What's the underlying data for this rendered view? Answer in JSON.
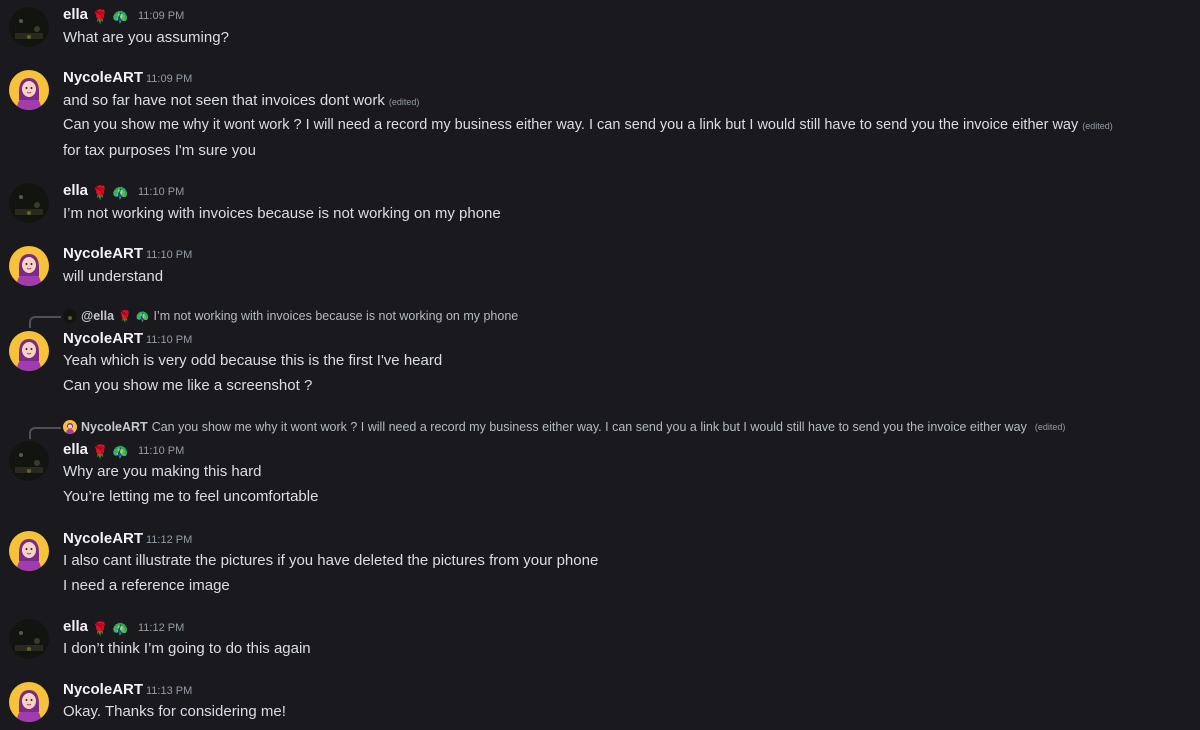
{
  "users": {
    "ella": {
      "name": "ella",
      "emoji_rose": "🌹",
      "emoji_peacock": "🦚"
    },
    "nycole": {
      "name": "NycoleART"
    }
  },
  "messages": [
    {
      "author": "ella",
      "time": "11:09 PM",
      "lines": [
        {
          "text": "What are you assuming?"
        }
      ]
    },
    {
      "author": "NycoleART",
      "time": "11:09 PM",
      "lines": [
        {
          "text": "and so far have not seen that invoices dont work",
          "edited": "(edited)"
        },
        {
          "text": "Can you show me why it wont work ? I will need a record my business either way. I can send you a link but I would still have to send you the invoice either way",
          "edited": "(edited)"
        },
        {
          "text": "for tax purposes I'm sure you"
        }
      ]
    },
    {
      "author": "ella",
      "time": "11:10 PM",
      "lines": [
        {
          "text": "I’m not working with invoices because is not working on my phone"
        }
      ]
    },
    {
      "author": "NycoleART",
      "time": "11:10 PM",
      "lines": [
        {
          "text": "will understand"
        }
      ]
    },
    {
      "author": "NycoleART",
      "time": "11:10 PM",
      "reply": {
        "name": "@ella",
        "text": "I’m not working with invoices because is not working on my phone"
      },
      "lines": [
        {
          "text": "Yeah which is very odd because this is the first I've heard"
        },
        {
          "text": "Can you show me like a screenshot ?"
        }
      ]
    },
    {
      "author": "ella",
      "time": "11:10 PM",
      "reply": {
        "name": "NycoleART",
        "text": "Can you show me why it wont work ? I will need a record my business either way. I can send you a link but I would still have to send you the invoice either way",
        "edited": "(edited)"
      },
      "lines": [
        {
          "text": "Why are you making this hard"
        },
        {
          "text": "You’re letting me to feel uncomfortable"
        }
      ]
    },
    {
      "author": "NycoleART",
      "time": "11:12 PM",
      "lines": [
        {
          "text": "I also cant illustrate the pictures if you have deleted the pictures from your phone"
        },
        {
          "text": "I need a reference image"
        }
      ]
    },
    {
      "author": "ella",
      "time": "11:12 PM",
      "lines": [
        {
          "text": "I don’t think I’m going to do this again"
        }
      ]
    },
    {
      "author": "NycoleART",
      "time": "11:13 PM",
      "lines": [
        {
          "text": "Okay. Thanks for considering me!"
        }
      ]
    }
  ],
  "icons": {
    "ella_avatar": "dark-night-photo-avatar",
    "nycole_avatar": "pink-haired-girl-avatar",
    "rose": "rose-emoji",
    "peacock": "peacock-emoji"
  }
}
